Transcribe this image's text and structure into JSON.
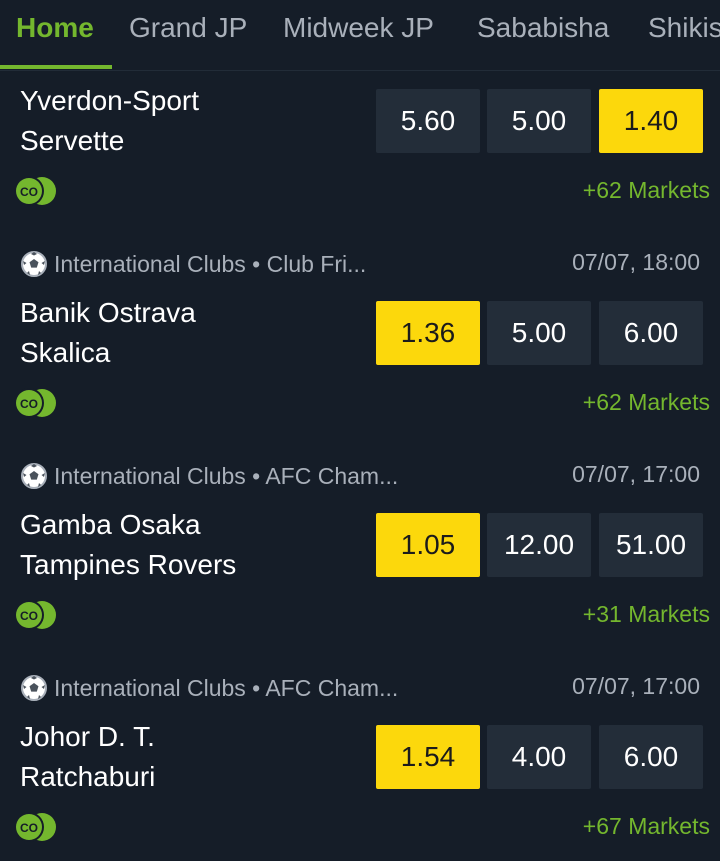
{
  "tabs": [
    {
      "label": "Home",
      "active": true
    },
    {
      "label": "Grand JP",
      "active": false
    },
    {
      "label": "Midweek JP",
      "active": false
    },
    {
      "label": "Sababisha",
      "active": false
    },
    {
      "label": "Shikis",
      "active": false
    }
  ],
  "matches": [
    {
      "league": "",
      "datetime": "",
      "home": "Yverdon-Sport",
      "away": "Servette",
      "odds": [
        "5.60",
        "5.00",
        "1.40"
      ],
      "selected_index": 2,
      "markets": "+62 Markets",
      "badge": "CO"
    },
    {
      "league": "International Clubs • Club Fri...",
      "datetime": "07/07, 18:00",
      "home": "Banik Ostrava",
      "away": "Skalica",
      "odds": [
        "1.36",
        "5.00",
        "6.00"
      ],
      "selected_index": 0,
      "markets": "+62 Markets",
      "badge": "CO"
    },
    {
      "league": "International Clubs • AFC Cham...",
      "datetime": "07/07, 17:00",
      "home": "Gamba Osaka",
      "away": "Tampines Rovers",
      "odds": [
        "1.05",
        "12.00",
        "51.00"
      ],
      "selected_index": 0,
      "markets": "+31 Markets",
      "badge": "CO"
    },
    {
      "league": "International Clubs • AFC Cham...",
      "datetime": "07/07, 17:00",
      "home": "Johor D. T.",
      "away": "Ratchaburi",
      "odds": [
        "1.54",
        "4.00",
        "6.00"
      ],
      "selected_index": 0,
      "markets": "+67 Markets",
      "badge": "CO"
    }
  ],
  "colors": {
    "background": "#151d28",
    "accent_green": "#74b72e",
    "selected_odd": "#fcd80c",
    "odd_bg": "#232d39"
  }
}
